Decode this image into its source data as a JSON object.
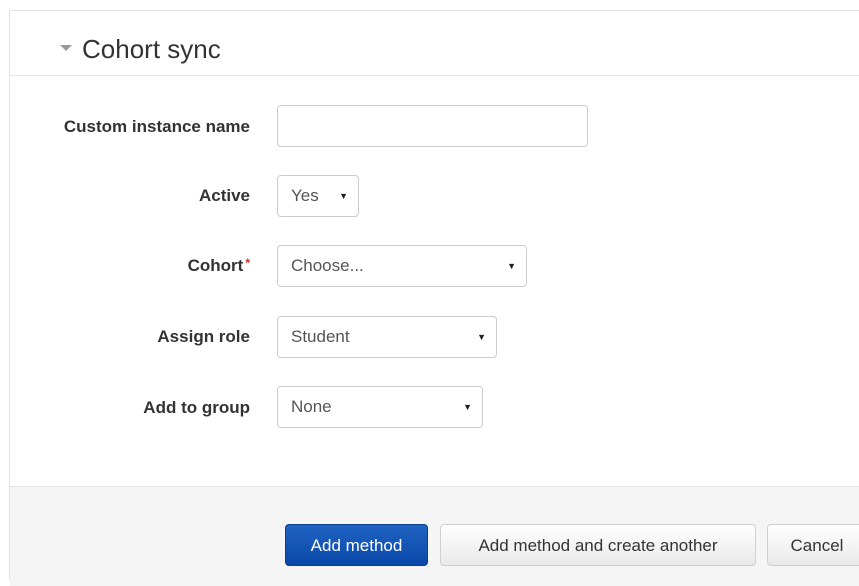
{
  "section": {
    "title": "Cohort sync"
  },
  "fields": {
    "custom_instance_name": {
      "label": "Custom instance name",
      "value": "",
      "placeholder": ""
    },
    "active": {
      "label": "Active",
      "value": "Yes"
    },
    "cohort": {
      "label": "Cohort",
      "required_marker": "*",
      "value": "Choose..."
    },
    "assign_role": {
      "label": "Assign role",
      "value": "Student"
    },
    "add_to_group": {
      "label": "Add to group",
      "value": "None"
    }
  },
  "buttons": {
    "add_method": "Add method",
    "add_method_and_create_another": "Add method and create another",
    "cancel": "Cancel"
  },
  "icons": {
    "collapse": "caret-down-icon",
    "select_arrow": "select-arrow-icon"
  },
  "colors": {
    "primary_button": "#0a48a8",
    "required_marker": "#c9302c",
    "footer_background": "#f5f5f5"
  }
}
